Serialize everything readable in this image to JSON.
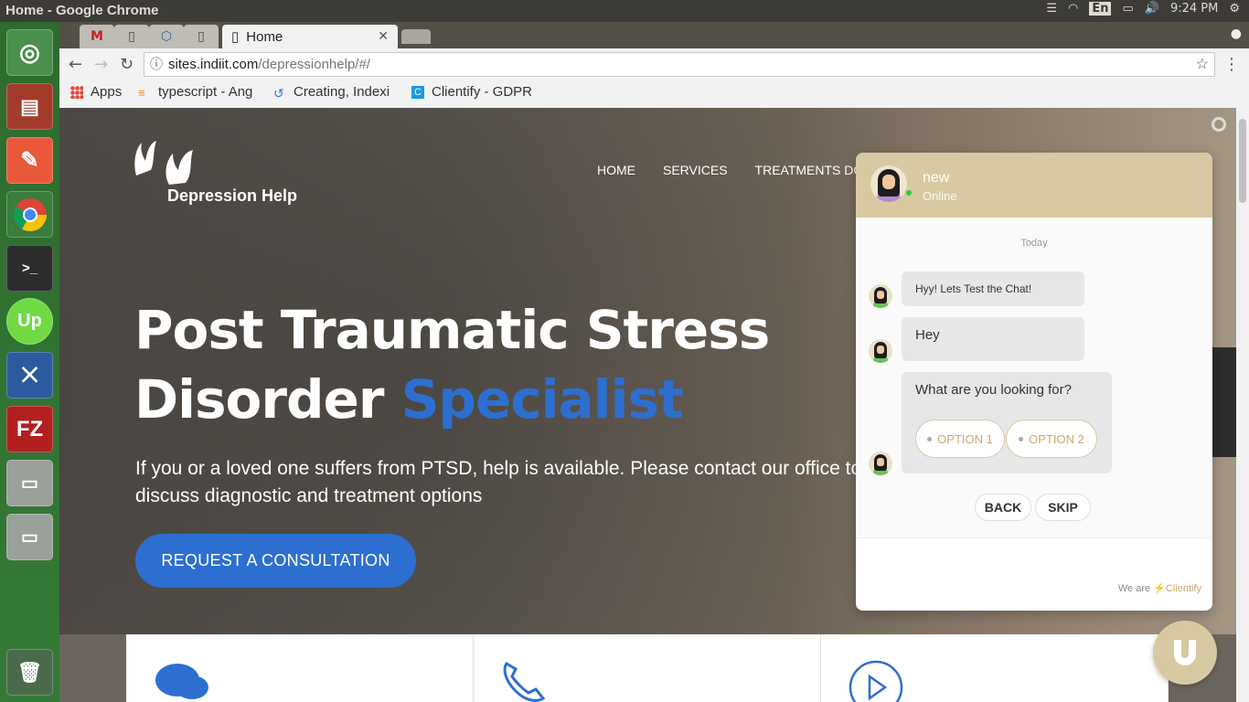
{
  "system": {
    "window_title": "Home - Google Chrome",
    "language": "En",
    "clock": "9:24 PM"
  },
  "browser": {
    "active_tab": "Home",
    "url_domain": "sites.indiit.com",
    "url_path": "/depressionhelp/#/",
    "bookmarks": [
      {
        "label": "Apps",
        "icon": "apps-grid-icon"
      },
      {
        "label": "typescript - Ang",
        "icon": "stackoverflow-icon"
      },
      {
        "label": "Creating, Indexi",
        "icon": "refresh-icon"
      },
      {
        "label": "Clientify - GDPR",
        "icon": "clientify-icon"
      }
    ]
  },
  "site": {
    "logo_text": "Depression Help",
    "nav": [
      "HOME",
      "SERVICES",
      "TREATMENTS DON"
    ],
    "headline_line1": "Post Traumatic Stress",
    "headline_line2_a": "Disorder ",
    "headline_line2_b": "Specialist",
    "subtitle": "If you or a loved one suffers from PTSD, help is available. Please contact our office to discuss diagnostic and treatment options",
    "cta": "REQUEST A CONSULTATION",
    "accent_color": "#2d6fd0"
  },
  "chat": {
    "agent_name": "new",
    "agent_status": "Online",
    "day_label": "Today",
    "messages": [
      "Hyy! Lets Test the Chat!",
      "Hey",
      "What are you looking for?"
    ],
    "options": [
      "OPTION 1",
      "OPTION 2"
    ],
    "back_label": "BACK",
    "skip_label": "SKIP",
    "powered_prefix": "We are",
    "powered_brand": "Clientify",
    "theme_color": "#d7c9a1"
  }
}
